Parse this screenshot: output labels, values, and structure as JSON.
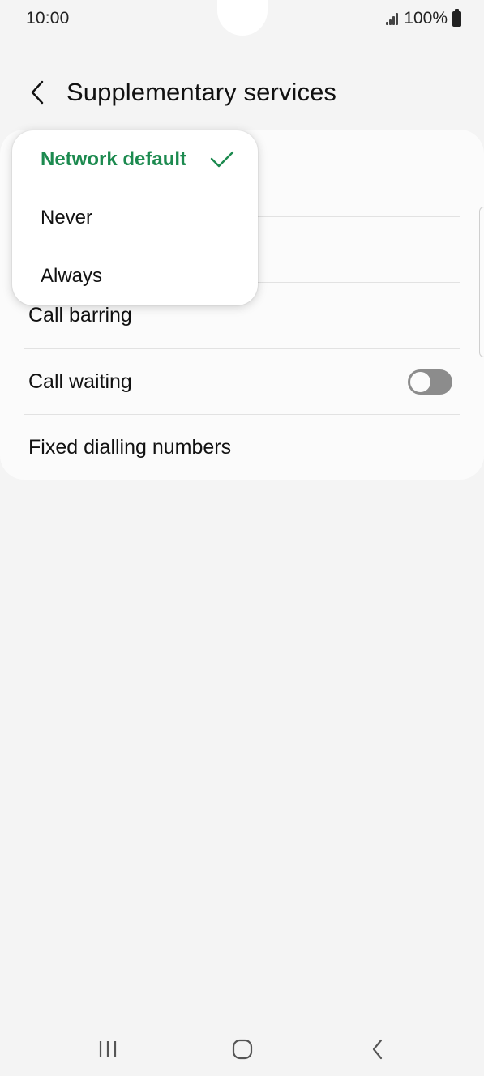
{
  "status_bar": {
    "time": "10:00",
    "battery": "100%",
    "icons": [
      "signal-icon",
      "battery-icon"
    ]
  },
  "header": {
    "title": "Supplementary services",
    "back_icon": "back-arrow-icon"
  },
  "settings": {
    "rows": [
      {
        "label": "Call barring"
      },
      {
        "label": "Call waiting",
        "toggle": "off"
      },
      {
        "label": "Fixed dialling numbers"
      }
    ]
  },
  "popup": {
    "options": [
      {
        "label": "Network default",
        "selected": true
      },
      {
        "label": "Never",
        "selected": false
      },
      {
        "label": "Always",
        "selected": false
      }
    ],
    "accent_color": "#1c8a4f"
  },
  "nav_bar": {
    "icons": [
      "recent-apps-icon",
      "home-icon",
      "back-icon"
    ]
  }
}
